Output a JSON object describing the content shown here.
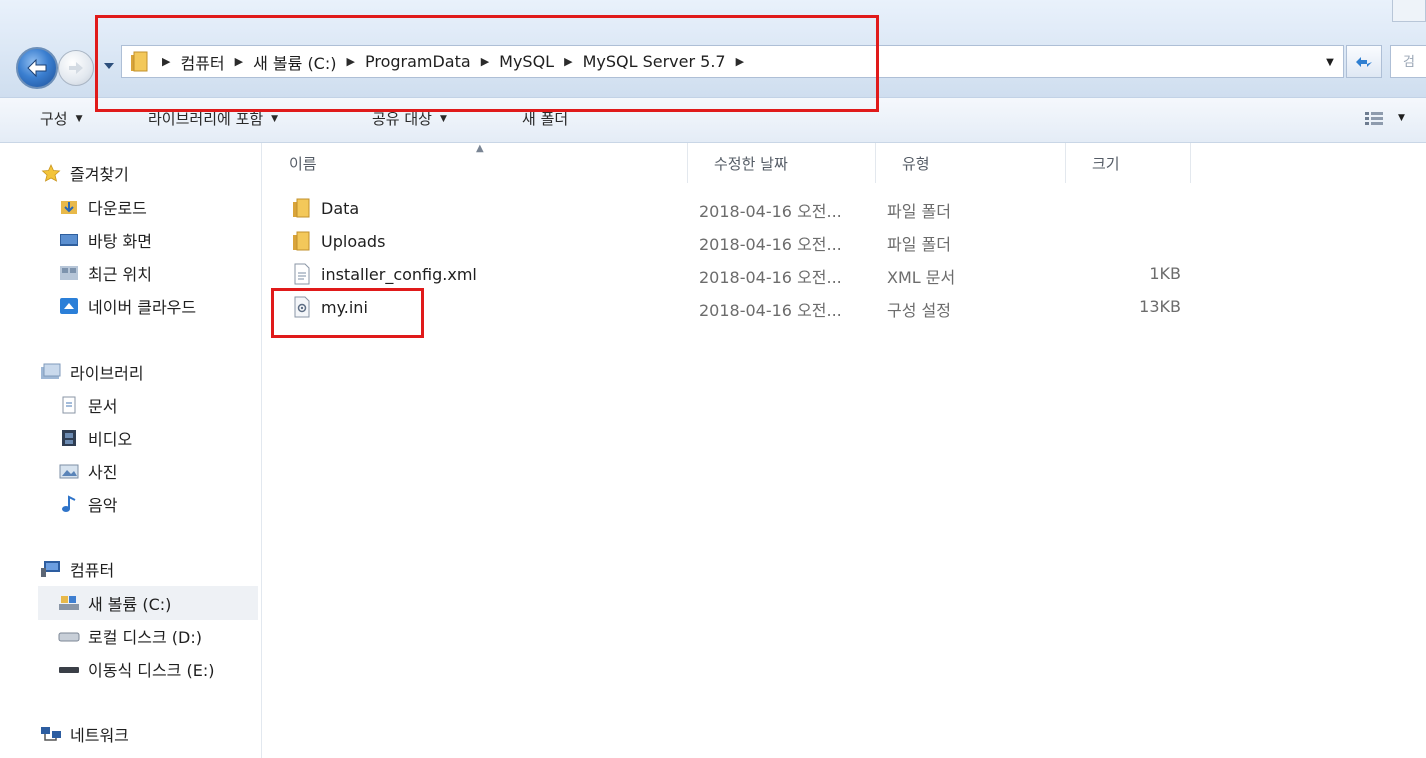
{
  "navigation": {
    "back_icon": "back-arrow-icon",
    "forward_icon": "forward-arrow-icon",
    "breadcrumbs": [
      "컴퓨터",
      "새 볼륨 (C:)",
      "ProgramData",
      "MySQL",
      "MySQL Server 5.7"
    ],
    "search_placeholder": "검"
  },
  "toolbar": {
    "organize_label": "구성",
    "include_library_label": "라이브러리에 포함",
    "share_label": "공유 대상",
    "new_folder_label": "새 폴더"
  },
  "sidebar": {
    "favorites": {
      "label": "즐겨찾기",
      "items": [
        {
          "label": "다운로드",
          "icon": "downloads-icon"
        },
        {
          "label": "바탕 화면",
          "icon": "desktop-icon"
        },
        {
          "label": "최근 위치",
          "icon": "recent-places-icon"
        },
        {
          "label": "네이버 클라우드",
          "icon": "cloud-icon"
        }
      ]
    },
    "libraries": {
      "label": "라이브러리",
      "items": [
        {
          "label": "문서",
          "icon": "documents-icon"
        },
        {
          "label": "비디오",
          "icon": "video-icon"
        },
        {
          "label": "사진",
          "icon": "pictures-icon"
        },
        {
          "label": "음악",
          "icon": "music-icon"
        }
      ]
    },
    "computer": {
      "label": "컴퓨터",
      "items": [
        {
          "label": "새 볼륨 (C:)",
          "icon": "drive-c-icon",
          "selected": true
        },
        {
          "label": "로컬 디스크 (D:)",
          "icon": "drive-d-icon"
        },
        {
          "label": "이동식 디스크 (E:)",
          "icon": "removable-drive-icon"
        }
      ]
    },
    "network": {
      "label": "네트워크"
    }
  },
  "files": {
    "columns": [
      "이름",
      "수정한 날짜",
      "유형",
      "크기"
    ],
    "rows": [
      {
        "name": "Data",
        "date": "2018-04-16 오전...",
        "type": "파일 폴더",
        "size": "",
        "icon": "folder-icon"
      },
      {
        "name": "Uploads",
        "date": "2018-04-16 오전...",
        "type": "파일 폴더",
        "size": "",
        "icon": "folder-icon"
      },
      {
        "name": "installer_config.xml",
        "date": "2018-04-16 오전...",
        "type": "XML 문서",
        "size": "1KB",
        "icon": "xml-file-icon"
      },
      {
        "name": "my.ini",
        "date": "2018-04-16 오전...",
        "type": "구성 설정",
        "size": "13KB",
        "icon": "settings-file-icon"
      }
    ]
  },
  "colors": {
    "highlight": "#e01a1a",
    "folder": "#e8b94a",
    "nav_back": "#3b7fd0"
  }
}
